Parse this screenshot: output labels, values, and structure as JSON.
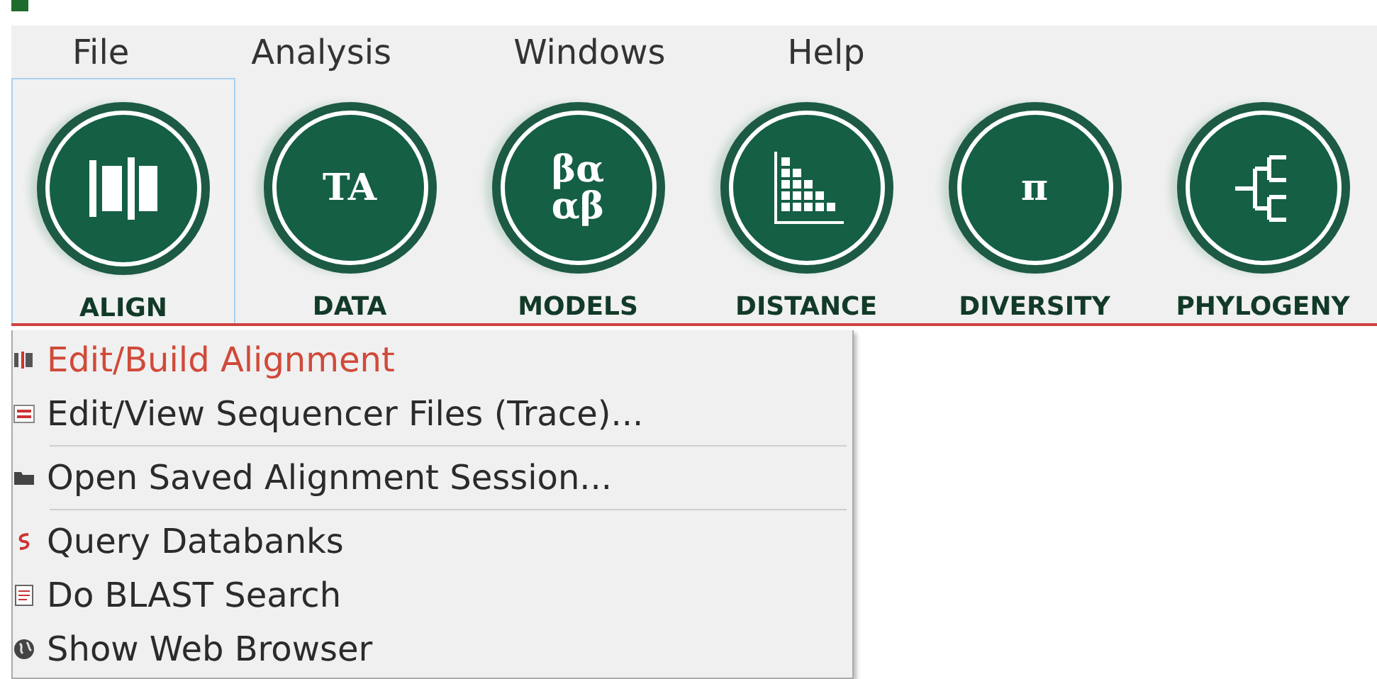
{
  "menu_bar": [
    {
      "label": "File"
    },
    {
      "label": "Analysis"
    },
    {
      "label": "Windows"
    },
    {
      "label": "Help"
    }
  ],
  "toolbar": [
    {
      "label": "ALIGN",
      "kind": "align",
      "selected": true
    },
    {
      "label": "DATA",
      "kind": "glyph",
      "glyph": "TA",
      "selected": false
    },
    {
      "label": "MODELS",
      "kind": "glyph",
      "glyph": "βα αβ",
      "selected": false
    },
    {
      "label": "DISTANCE",
      "kind": "distance",
      "selected": false
    },
    {
      "label": "DIVERSITY",
      "kind": "glyph",
      "glyph": "π",
      "selected": false
    },
    {
      "label": "PHYLOGENY",
      "kind": "tree",
      "selected": false
    }
  ],
  "dropdown": {
    "items": [
      {
        "label": "Edit/Build Alignment",
        "kind": "align",
        "selected": true,
        "separator_after": false
      },
      {
        "label": "Edit/View Sequencer Files (Trace)...",
        "kind": "trace",
        "selected": false,
        "separator_after": true
      },
      {
        "label": "Open Saved Alignment Session...",
        "kind": "folder",
        "selected": false,
        "separator_after": true
      },
      {
        "label": "Query Databanks",
        "kind": "query",
        "selected": false,
        "separator_after": false
      },
      {
        "label": "Do BLAST Search",
        "kind": "doc",
        "selected": false,
        "separator_after": false
      },
      {
        "label": "Show Web Browser",
        "kind": "globe",
        "selected": false,
        "separator_after": false
      }
    ]
  }
}
